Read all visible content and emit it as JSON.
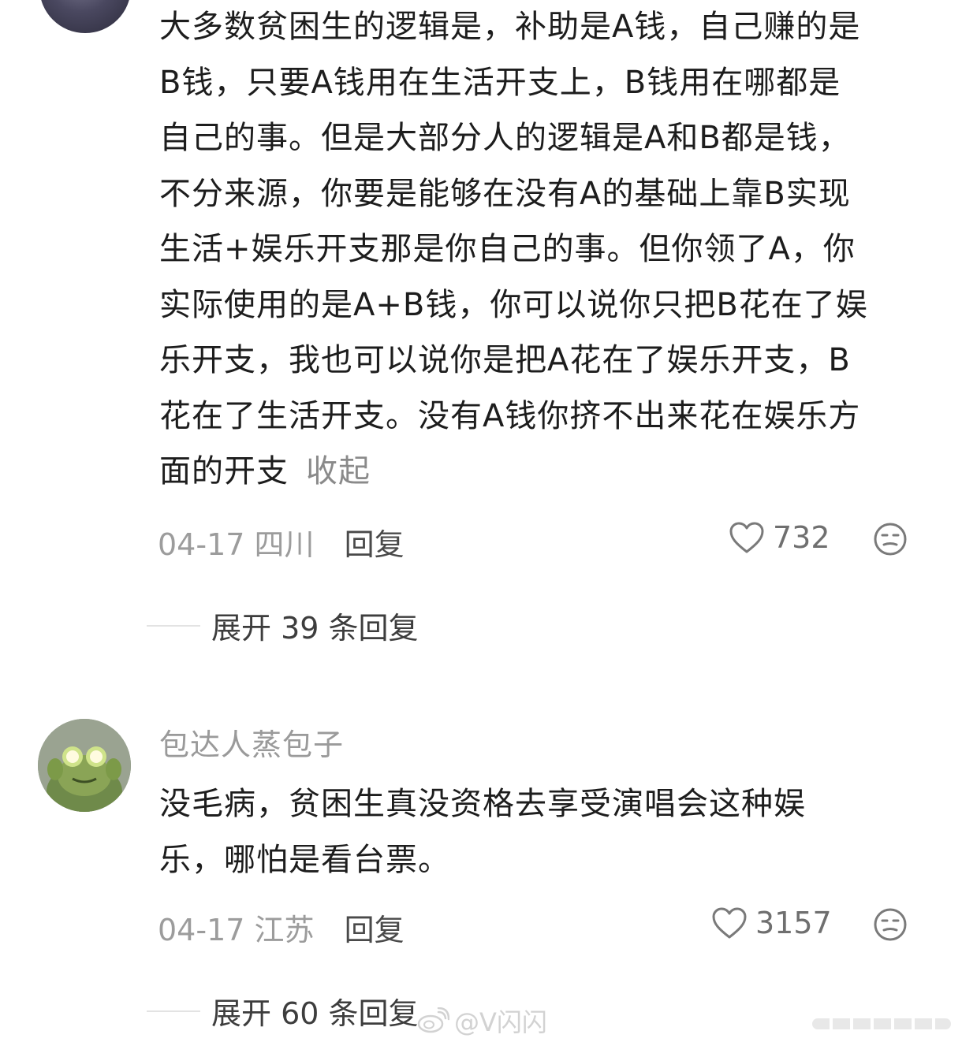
{
  "comments": [
    {
      "lines": [
        "大多数贫困生的逻辑是，补助是A钱，自己赚的是",
        "B钱，只要A钱用在生活开支上，B钱用在哪都是",
        "自己的事。但是大部分人的逻辑是A和B都是钱，",
        "不分来源，你要是能够在没有A的基础上靠B实现",
        "生活+娱乐开支那是你自己的事。但你领了A，你",
        "实际使用的是A+B钱，你可以说你只把B花在了娱",
        "乐开支，我也可以说你是把A花在了娱乐开支，B",
        "花在了生活开支。没有A钱你挤不出来花在娱乐方",
        "面的开支"
      ],
      "collapse_label": "收起",
      "date": "04-17",
      "location": "四川",
      "reply_label": "回复",
      "likes": "732",
      "expand_label": "展开 39 条回复"
    },
    {
      "username": "包达人蒸包子",
      "lines": [
        "没毛病，贫困生真没资格去享受演唱会这种娱",
        "乐，哪怕是看台票。"
      ],
      "date": "04-17",
      "location": "江苏",
      "reply_label": "回复",
      "likes": "3157",
      "expand_label": "展开 60 条回复"
    }
  ],
  "watermark": "@V闪闪"
}
